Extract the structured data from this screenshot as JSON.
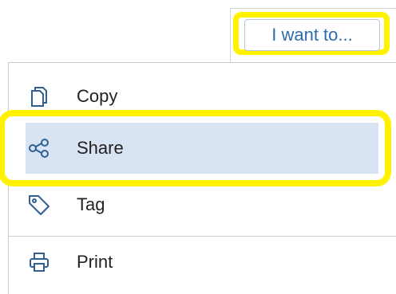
{
  "header": {
    "menu_button_label": "I want to..."
  },
  "menu": {
    "items": [
      {
        "label": "Copy",
        "icon": "copy-icon"
      },
      {
        "label": "Share",
        "icon": "share-icon",
        "selected": true
      },
      {
        "label": "Tag",
        "icon": "tag-icon"
      },
      {
        "label": "Print",
        "icon": "print-icon"
      }
    ]
  },
  "colors": {
    "highlight": "#fff200",
    "selected_row": "#d8e3f3",
    "link_blue": "#2b6cb0",
    "icon_blue": "#2f5f93"
  }
}
